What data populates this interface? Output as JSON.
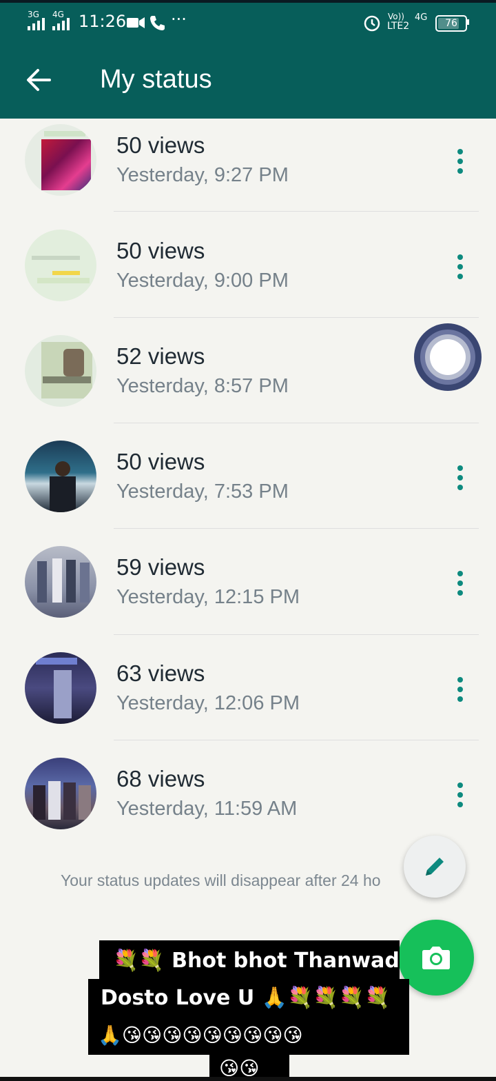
{
  "status_bar": {
    "network1": "3G",
    "network2": "4G",
    "time": "11:26",
    "volte": "Vo))",
    "lte": "LTE2",
    "network3": "4G",
    "battery": "76"
  },
  "app_bar": {
    "title": "My status"
  },
  "statuses": [
    {
      "views": "50 views",
      "time": "Yesterday, 9:27 PM"
    },
    {
      "views": "50 views",
      "time": "Yesterday, 9:00 PM"
    },
    {
      "views": "52 views",
      "time": "Yesterday, 8:57 PM"
    },
    {
      "views": "50 views",
      "time": "Yesterday, 7:53 PM"
    },
    {
      "views": "59 views",
      "time": "Yesterday, 12:15 PM"
    },
    {
      "views": "63 views",
      "time": "Yesterday, 12:06 PM"
    },
    {
      "views": "68 views",
      "time": "Yesterday, 11:59 AM"
    }
  ],
  "footer_note": "Your status updates will disappear after 24 ho",
  "caption": {
    "line1": "💐💐 Bhot bhot Thanwad",
    "line2": "Dosto Love U 🙏💐💐💐💐",
    "line3": "🙏😘😘😘😘😘😘😘😘😘",
    "line4": "😘😘"
  },
  "colors": {
    "header": "#075e5a",
    "accent": "#0d8a7f",
    "fab": "#16c05a",
    "background": "#f4f4f0"
  }
}
